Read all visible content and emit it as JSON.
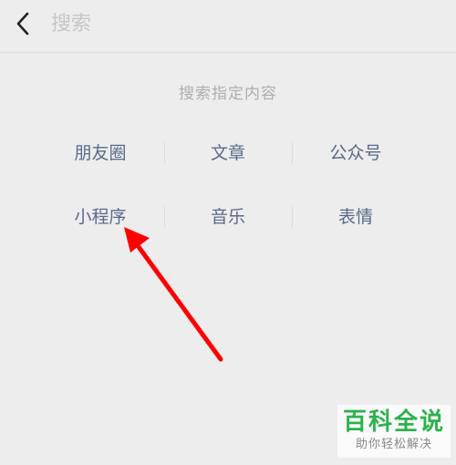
{
  "header": {
    "back_icon": "chevron-left-icon",
    "search_placeholder": "搜索"
  },
  "section": {
    "title": "搜索指定内容"
  },
  "categories": [
    [
      "朋友圈",
      "文章",
      "公众号"
    ],
    [
      "小程序",
      "音乐",
      "表情"
    ]
  ],
  "annotation": {
    "arrow_color": "#ff0000"
  },
  "watermark": {
    "title": "百科全说",
    "subtitle": "助你轻松解决"
  },
  "colors": {
    "background": "#ededed",
    "category_text": "#5a6a8a",
    "muted_text": "#aeaeae",
    "watermark_green": "#2bb24c"
  }
}
